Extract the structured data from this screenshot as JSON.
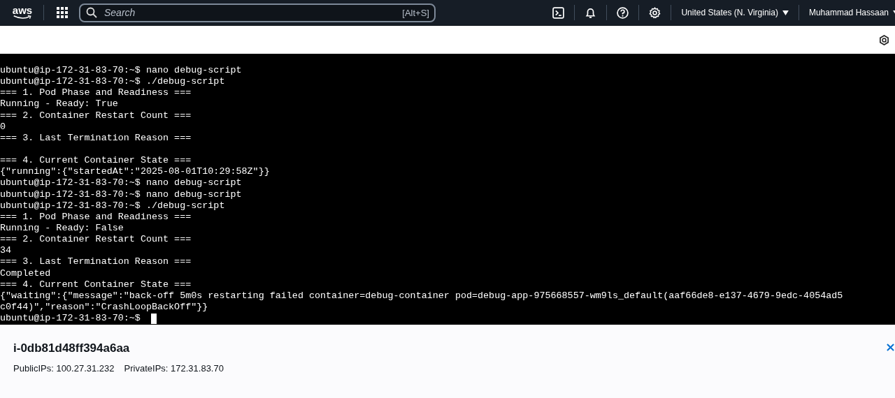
{
  "top_nav": {
    "logo": "aws",
    "search": {
      "placeholder": "Search",
      "shortcut": "[Alt+S]"
    },
    "region": "United States (N. Virginia)",
    "user": "Muhammad Hassaan"
  },
  "terminal": {
    "lines": [
      {
        "kind": "text",
        "text": "ubuntu@ip-172-31-83-70:~$ nano debug-script"
      },
      {
        "kind": "text",
        "text": "ubuntu@ip-172-31-83-70:~$ ./debug-script"
      },
      {
        "kind": "text",
        "text": "=== 1. Pod Phase and Readiness ==="
      },
      {
        "kind": "text",
        "text": "Running - Ready: True"
      },
      {
        "kind": "text",
        "text": "=== 2. Container Restart Count ==="
      },
      {
        "kind": "text",
        "text": "0"
      },
      {
        "kind": "text",
        "text": "=== 3. Last Termination Reason ==="
      },
      {
        "kind": "blank"
      },
      {
        "kind": "text",
        "text": "=== 4. Current Container State ==="
      },
      {
        "kind": "text",
        "text": "{\"running\":{\"startedAt\":\"2025-08-01T10:29:58Z\"}}"
      },
      {
        "kind": "text",
        "text": "ubuntu@ip-172-31-83-70:~$ nano debug-script"
      },
      {
        "kind": "text",
        "text": "ubuntu@ip-172-31-83-70:~$ nano debug-script"
      },
      {
        "kind": "text",
        "text": "ubuntu@ip-172-31-83-70:~$ ./debug-script"
      },
      {
        "kind": "text",
        "text": "=== 1. Pod Phase and Readiness ==="
      },
      {
        "kind": "text",
        "text": "Running - Ready: False"
      },
      {
        "kind": "text",
        "text": "=== 2. Container Restart Count ==="
      },
      {
        "kind": "text",
        "text": "34"
      },
      {
        "kind": "text",
        "text": "=== 3. Last Termination Reason ==="
      },
      {
        "kind": "text",
        "text": "Completed"
      },
      {
        "kind": "text",
        "text": "=== 4. Current Container State ==="
      },
      {
        "kind": "text",
        "text": "{\"waiting\":{\"message\":\"back-off 5m0s restarting failed container=debug-container pod=debug-app-975668557-wm9ls_default(aaf66de8-e137-4679-9edc-4054ad5"
      },
      {
        "kind": "text",
        "text": "c0f44)\",\"reason\":\"CrashLoopBackOff\"}}"
      },
      {
        "kind": "prompt",
        "text": "ubuntu@ip-172-31-83-70:~$",
        "cursor": true
      }
    ]
  },
  "instance_panel": {
    "title": "i-0db81d48ff394a6aa",
    "public_ips": "PublicIPs: 100.27.31.232",
    "private_ips": "PrivateIPs: 172.31.83.70"
  }
}
